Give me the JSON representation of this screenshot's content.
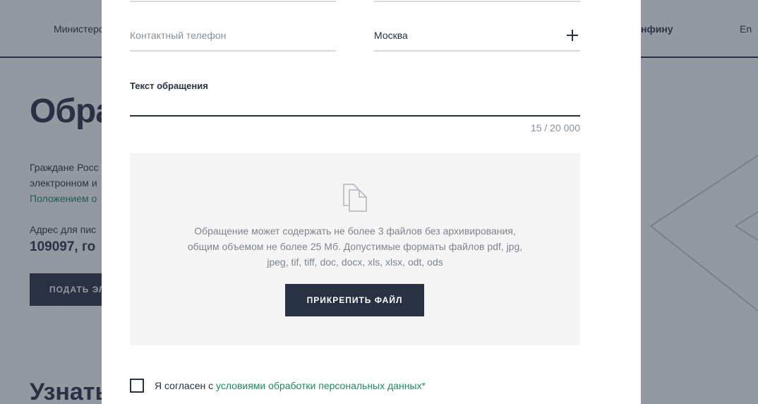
{
  "background": {
    "nav_left": "Министерство",
    "nav_right": "нфину",
    "lang": "En",
    "title": "Обра",
    "lines": [
      "Граждане Росс",
      "электронном и",
      "Положением о"
    ],
    "address_label": "Адрес для пис",
    "address_value": "109097, го",
    "submit_button": "ПОДАТЬ ЭЛ",
    "section_title": "Узнать"
  },
  "form": {
    "phone_placeholder": "Контактный телефон",
    "city_value": "Москва",
    "message_label": "Текст обращения",
    "counter": "15 / 20 000",
    "upload": {
      "icon": "documents-icon",
      "lines": [
        "Обращение может содержать не более 3 файлов без архивирования,",
        "общим объемом не более 25 Мб. Допустимые форматы файлов pdf, jpg,",
        "jpeg, tif, tiff, doc, docx, xls, xlsx, odt, ods"
      ],
      "button": "ПРИКРЕПИТЬ ФАЙЛ"
    },
    "consent": {
      "prefix": "Я согласен с ",
      "link": "условиями обработки персональных данных*"
    }
  },
  "colors": {
    "primary": "#2a3142",
    "link": "#1f8a5b",
    "muted": "#8a8f99",
    "upload_bg": "#f5f5f5",
    "overlay": "rgba(42,49,66,0.5)"
  }
}
